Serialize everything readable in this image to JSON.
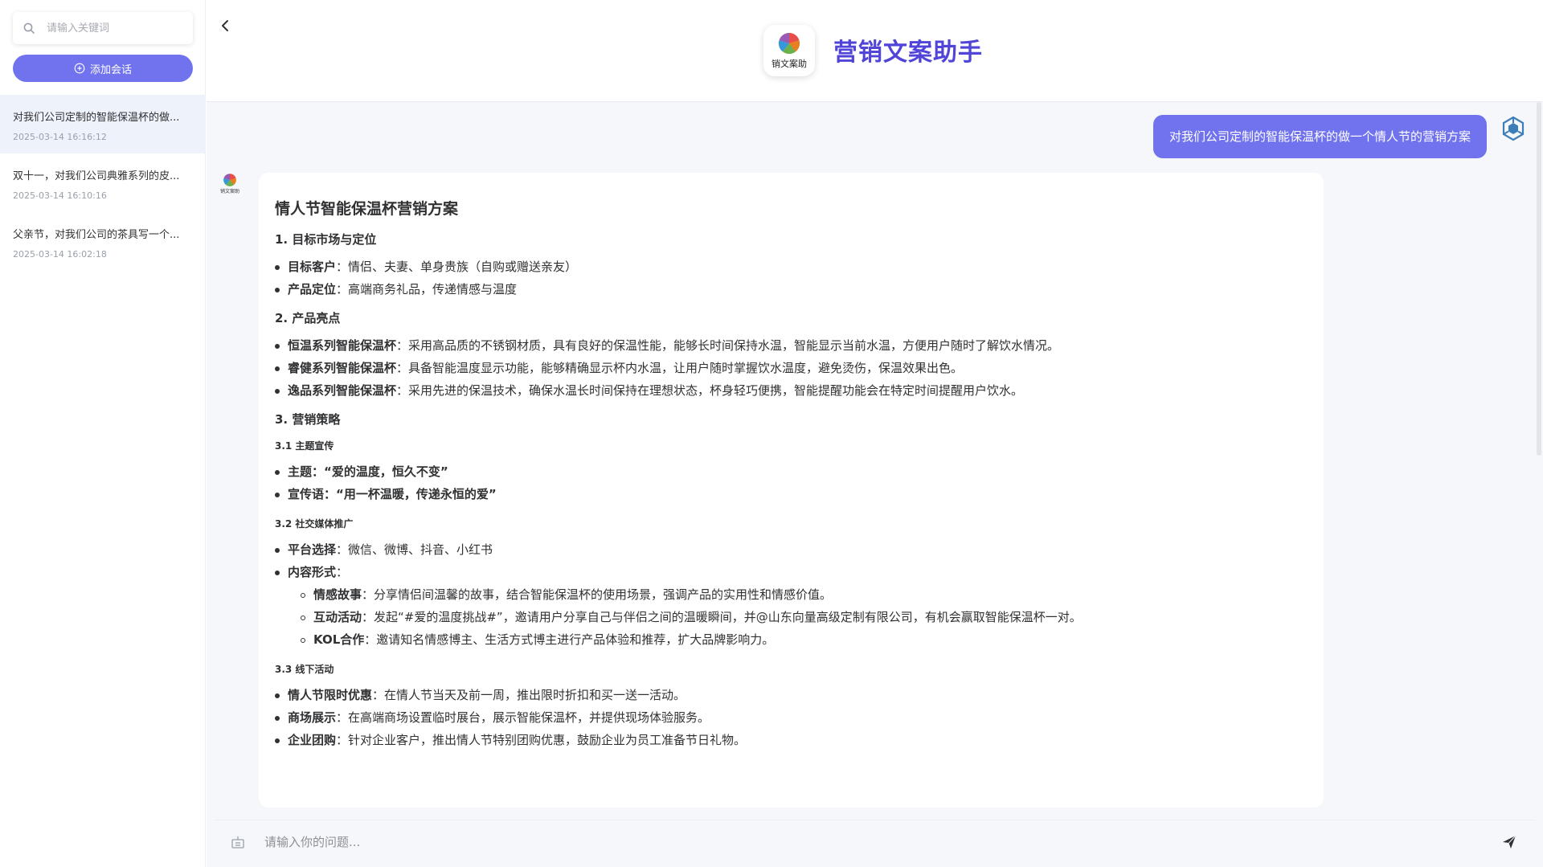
{
  "sidebar": {
    "search_placeholder": "请输入关键词",
    "add_button_label": "添加会话",
    "conversations": [
      {
        "title": "对我们公司定制的智能保温杯的做...",
        "time": "2025-03-14 16:16:12"
      },
      {
        "title": "双十一，对我们公司典雅系列的皮...",
        "time": "2025-03-14 16:10:16"
      },
      {
        "title": "父亲节，对我们公司的茶具写一个...",
        "time": "2025-03-14 16:02:18"
      }
    ]
  },
  "header": {
    "title": "营销文案助手",
    "logo_text": "销文案助"
  },
  "chat": {
    "user_message": "对我们公司定制的智能保温杯的做一个情人节的营销方案",
    "bot_avatar_text": "销文案助",
    "answer": {
      "title": "情人节智能保温杯营销方案",
      "s1": {
        "heading": "1. 目标市场与定位",
        "items": [
          {
            "label": "目标客户",
            "text": "：情侣、夫妻、单身贵族（自购或赠送亲友）"
          },
          {
            "label": "产品定位",
            "text": "：高端商务礼品，传递情感与温度"
          }
        ]
      },
      "s2": {
        "heading": "2. 产品亮点",
        "items": [
          {
            "label": "恒温系列智能保温杯",
            "text": "：采用高品质的不锈钢材质，具有良好的保温性能，能够长时间保持水温，智能显示当前水温，方便用户随时了解饮水情况。"
          },
          {
            "label": "睿健系列智能保温杯",
            "text": "：具备智能温度显示功能，能够精确显示杯内水温，让用户随时掌握饮水温度，避免烫伤，保温效果出色。"
          },
          {
            "label": "逸品系列智能保温杯",
            "text": "：采用先进的保温技术，确保水温长时间保持在理想状态，杯身轻巧便携，智能提醒功能会在特定时间提醒用户饮水。"
          }
        ]
      },
      "s3": {
        "heading": "3. 营销策略",
        "sub1": {
          "heading": "3.1 主题宣传",
          "items": [
            {
              "label": "主题",
              "text": "：“爱的温度，恒久不变”"
            },
            {
              "label": "宣传语",
              "text": "：“用一杯温暖，传递永恒的爱”"
            }
          ]
        },
        "sub2": {
          "heading": "3.2 社交媒体推广",
          "items": [
            {
              "label": "平台选择",
              "text": "：微信、微博、抖音、小红书"
            },
            {
              "label": "内容形式",
              "text": "："
            }
          ],
          "nested": [
            {
              "label": "情感故事",
              "text": "：分享情侣间温馨的故事，结合智能保温杯的使用场景，强调产品的实用性和情感价值。"
            },
            {
              "label": "互动活动",
              "text": "：发起“#爱的温度挑战#”，邀请用户分享自己与伴侣之间的温暖瞬间，并@山东向量高级定制有限公司，有机会赢取智能保温杯一对。"
            },
            {
              "label": "KOL合作",
              "text": "：邀请知名情感博主、生活方式博主进行产品体验和推荐，扩大品牌影响力。"
            }
          ]
        },
        "sub3": {
          "heading": "3.3 线下活动",
          "items": [
            {
              "label": "情人节限时优惠",
              "text": "：在情人节当天及前一周，推出限时折扣和买一送一活动。"
            },
            {
              "label": "商场展示",
              "text": "：在高端商场设置临时展台，展示智能保温杯，并提供现场体验服务。"
            },
            {
              "label": "企业团购",
              "text": "：针对企业客户，推出情人节特别团购优惠，鼓励企业为员工准备节日礼物。"
            }
          ]
        }
      }
    }
  },
  "input": {
    "placeholder": "请输入你的问题..."
  },
  "colors": {
    "accent": "#7173ee",
    "title": "#5045d8",
    "active_item_bg": "#eef2fb",
    "main_bg": "#f5f7fb"
  },
  "icons": [
    "search-icon",
    "plus-circle-icon",
    "chevron-left-icon",
    "app-logo",
    "user-avatar-icon",
    "bot-avatar",
    "attachment-icon",
    "send-icon"
  ]
}
